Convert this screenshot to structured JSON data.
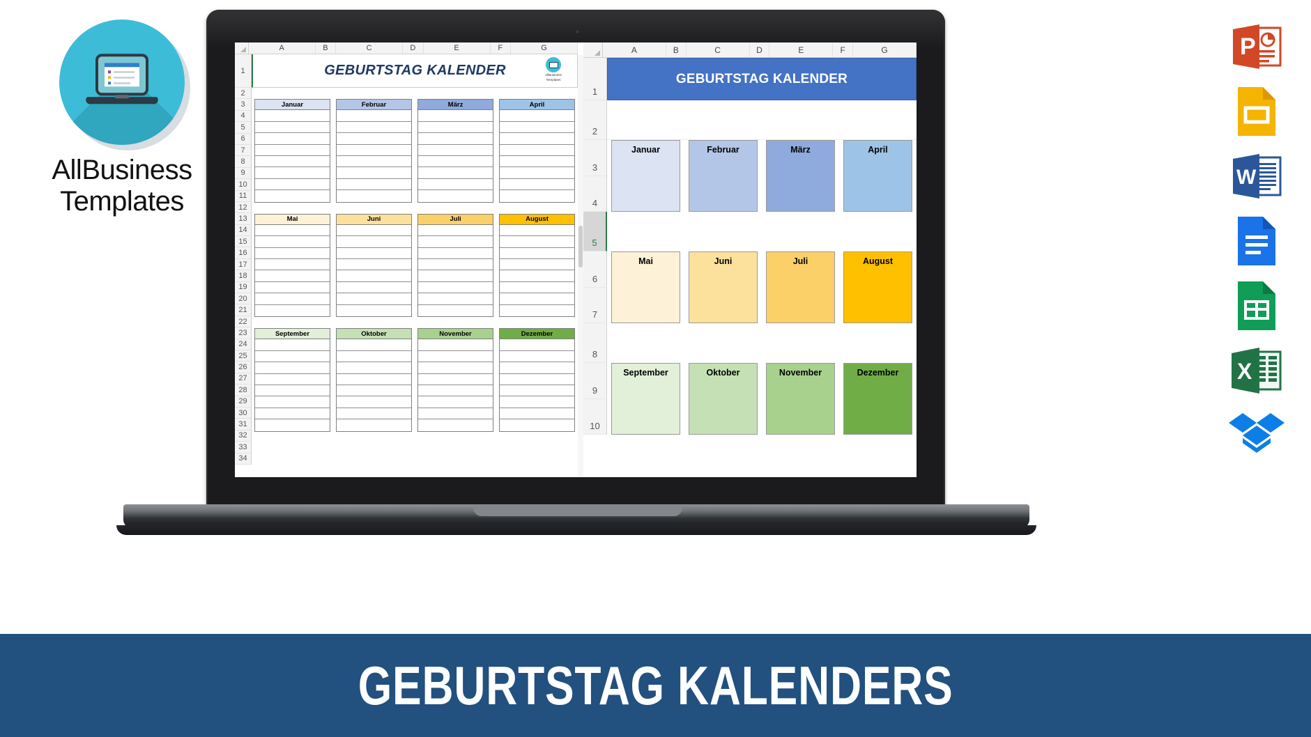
{
  "brand": {
    "line1": "AllBusiness",
    "line2": "Templates",
    "logo_icon": "laptop-list-icon",
    "circle_color": "#3dbcd8"
  },
  "banner": {
    "text": "GEBURTSTAG KALENDERS",
    "bg_color": "#22507f",
    "text_color": "#ffffff"
  },
  "laptop": {
    "frame_color": "#1b1b1d",
    "webcam_icon": "webcam-dot-icon"
  },
  "sheet_left": {
    "name": "geburtstag-kalender-list-view",
    "column_headers": [
      "A",
      "B",
      "C",
      "D",
      "E",
      "F",
      "G"
    ],
    "row_numbers": [
      "1",
      "2",
      "3",
      "4",
      "5",
      "6",
      "7",
      "8",
      "9",
      "10",
      "11",
      "12",
      "13",
      "14",
      "15",
      "16",
      "17",
      "18",
      "19",
      "20",
      "21",
      "22",
      "23",
      "24",
      "25",
      "26",
      "27",
      "28",
      "29",
      "30",
      "31",
      "32",
      "33",
      "34"
    ],
    "title": "GEBURTSTAG KALENDER",
    "title_color": "#1f3864",
    "logo_caption_1": "AllBusiness",
    "logo_caption_2": "Templates",
    "month_rows": [
      {
        "header_row": "3",
        "months": [
          {
            "label": "Januar",
            "color": "#dce3f2"
          },
          {
            "label": "Februar",
            "color": "#b4c6e7"
          },
          {
            "label": "März",
            "color": "#8faadc"
          },
          {
            "label": "April",
            "color": "#9dc3e6"
          }
        ]
      },
      {
        "header_row": "13",
        "months": [
          {
            "label": "Mai",
            "color": "#fdf2d8"
          },
          {
            "label": "Juni",
            "color": "#fce19c"
          },
          {
            "label": "Juli",
            "color": "#fcd069"
          },
          {
            "label": "August",
            "color": "#ffc000"
          }
        ]
      },
      {
        "header_row": "23",
        "months": [
          {
            "label": "September",
            "color": "#e2efd9"
          },
          {
            "label": "Oktober",
            "color": "#c5e0b4"
          },
          {
            "label": "November",
            "color": "#a9d18e"
          },
          {
            "label": "Dezember",
            "color": "#70ad47"
          }
        ]
      }
    ],
    "entry_lines_per_month": 8
  },
  "sheet_right": {
    "name": "geburtstag-kalender-block-view",
    "column_headers": [
      "A",
      "B",
      "C",
      "D",
      "E",
      "F",
      "G"
    ],
    "row_numbers": [
      "1",
      "2",
      "3",
      "4",
      "5",
      "6",
      "7",
      "8",
      "9",
      "10"
    ],
    "selected_row": "5",
    "title": "GEBURTSTAG KALENDER",
    "title_bg": "#4472c4",
    "title_color": "#ffffff",
    "month_rows": [
      {
        "months": [
          {
            "label": "Januar",
            "color": "#dce3f2"
          },
          {
            "label": "Februar",
            "color": "#b4c6e7"
          },
          {
            "label": "März",
            "color": "#8faadc"
          },
          {
            "label": "April",
            "color": "#9dc3e6"
          }
        ]
      },
      {
        "months": [
          {
            "label": "Mai",
            "color": "#fdf2d8"
          },
          {
            "label": "Juni",
            "color": "#fce19c"
          },
          {
            "label": "Juli",
            "color": "#fcd069"
          },
          {
            "label": "August",
            "color": "#ffc000"
          }
        ]
      },
      {
        "months": [
          {
            "label": "September",
            "color": "#e2efd9"
          },
          {
            "label": "Oktober",
            "color": "#c5e0b4"
          },
          {
            "label": "November",
            "color": "#a9d18e"
          },
          {
            "label": "Dezember",
            "color": "#70ad47"
          }
        ]
      }
    ]
  },
  "app_icons": [
    {
      "name": "powerpoint-icon",
      "label": "PowerPoint",
      "color": "#d24726"
    },
    {
      "name": "google-slides-icon",
      "label": "Google Slides",
      "color": "#f4b400"
    },
    {
      "name": "word-icon",
      "label": "Word",
      "color": "#2b579a"
    },
    {
      "name": "google-docs-icon",
      "label": "Google Docs",
      "color": "#1a73e8"
    },
    {
      "name": "google-sheets-icon",
      "label": "Google Sheets",
      "color": "#0f9d58"
    },
    {
      "name": "excel-icon",
      "label": "Excel",
      "color": "#217346"
    },
    {
      "name": "dropbox-icon",
      "label": "Dropbox",
      "color": "#0d7ee8"
    }
  ]
}
